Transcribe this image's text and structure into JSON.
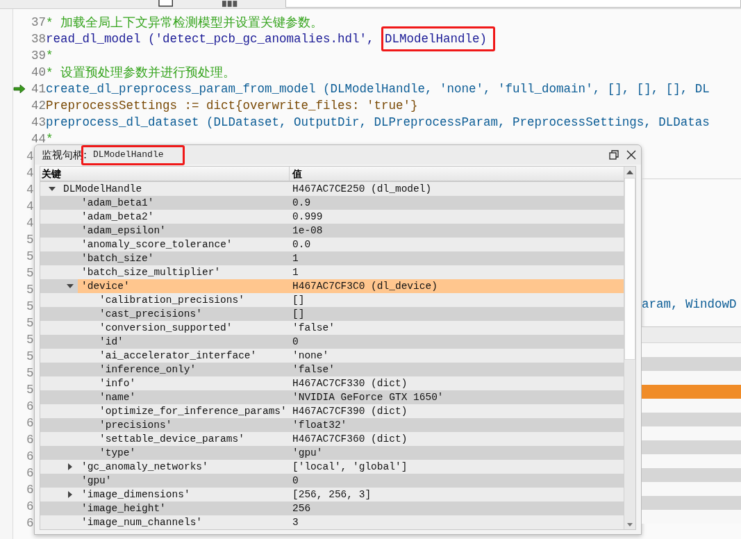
{
  "editor": {
    "lines": [
      {
        "number": "37",
        "current": false,
        "tokens": [
          {
            "text": "* 加载全局上下文异常检测模型并设置关键参数。",
            "kind": "comment",
            "boxed": false
          }
        ]
      },
      {
        "number": "38",
        "current": false,
        "tokens": [
          {
            "text": "read_dl_model ('detect_pcb_gc_anomalies.hdl', ",
            "kind": "operator",
            "boxed": false
          },
          {
            "text": "DLModelHandle)",
            "kind": "operator",
            "boxed": true
          }
        ]
      },
      {
        "number": "39",
        "current": false,
        "tokens": [
          {
            "text": "*",
            "kind": "comment",
            "boxed": false
          }
        ]
      },
      {
        "number": "40",
        "current": false,
        "tokens": [
          {
            "text": "* 设置预处理参数并进行预处理。",
            "kind": "comment",
            "boxed": false
          }
        ]
      },
      {
        "number": "41",
        "current": true,
        "tokens": [
          {
            "text": "create_dl_preprocess_param_from_model (DLModelHandle, 'none', 'full_domain', [], [], [], DL",
            "kind": "procedure",
            "boxed": false
          }
        ]
      },
      {
        "number": "42",
        "current": false,
        "tokens": [
          {
            "text": "PreprocessSettings := dict{overwrite_files: 'true'}",
            "kind": "assignment",
            "boxed": false
          }
        ]
      },
      {
        "number": "43",
        "current": false,
        "tokens": [
          {
            "text": "preprocess_dl_dataset (DLDataset, OutputDir, DLPreprocessParam, PreprocessSettings, DLDatas",
            "kind": "procedure",
            "boxed": false
          }
        ]
      },
      {
        "number": "44",
        "current": false,
        "tokens": [
          {
            "text": "*",
            "kind": "comment",
            "boxed": false
          }
        ]
      }
    ],
    "hidden_line_digits": [
      "4",
      "4",
      "4",
      "4",
      "4",
      "5",
      "5",
      "5",
      "5",
      "5",
      "5",
      "5",
      "5",
      "5",
      "5",
      "6",
      "6",
      "6",
      "6",
      "6",
      "6",
      "6",
      "6"
    ],
    "code_fragment": "aram, WindowD"
  },
  "watch_window": {
    "title": "监视句柄:",
    "handle": "DLModelHandle",
    "handle_boxed": true,
    "columns": [
      "关键",
      "值"
    ],
    "rows": [
      {
        "key": "DLModelHandle",
        "value": "H467AC7CE250 (dl_model)",
        "expanded": true,
        "selected": false,
        "children": [
          {
            "key": "'adam_beta1'",
            "value": "0.9",
            "selected": false
          },
          {
            "key": "'adam_beta2'",
            "value": "0.999",
            "selected": false
          },
          {
            "key": "'adam_epsilon'",
            "value": "1e-08",
            "selected": false
          },
          {
            "key": "'anomaly_score_tolerance'",
            "value": "0.0",
            "selected": false
          },
          {
            "key": "'batch_size'",
            "value": "1",
            "selected": false
          },
          {
            "key": "'batch_size_multiplier'",
            "value": "1",
            "selected": false
          },
          {
            "key": "'device'",
            "value": "H467AC7CF3C0 (dl_device)",
            "expanded": true,
            "selected": true,
            "children": [
              {
                "key": "'calibration_precisions'",
                "value": "[]",
                "selected": false
              },
              {
                "key": "'cast_precisions'",
                "value": "[]",
                "selected": false
              },
              {
                "key": "'conversion_supported'",
                "value": "'false'",
                "selected": false
              },
              {
                "key": "'id'",
                "value": "0",
                "selected": false
              },
              {
                "key": "'ai_accelerator_interface'",
                "value": "'none'",
                "selected": false
              },
              {
                "key": "'inference_only'",
                "value": "'false'",
                "selected": false
              },
              {
                "key": "'info'",
                "value": "H467AC7CF330 (dict)",
                "selected": false
              },
              {
                "key": "'name'",
                "value": "'NVIDIA GeForce GTX 1650'",
                "selected": false
              },
              {
                "key": "'optimize_for_inference_params'",
                "value": "H467AC7CF390 (dict)",
                "selected": false
              },
              {
                "key": "'precisions'",
                "value": "'float32'",
                "selected": false
              },
              {
                "key": "'settable_device_params'",
                "value": "H467AC7CF360 (dict)",
                "selected": false
              },
              {
                "key": "'type'",
                "value": "'gpu'",
                "selected": false
              }
            ]
          },
          {
            "key": "'gc_anomaly_networks'",
            "value": "['local', 'global']",
            "expanded": false,
            "selected": false
          },
          {
            "key": "'gpu'",
            "value": "0",
            "selected": false
          },
          {
            "key": "'image_dimensions'",
            "value": "[256, 256, 3]",
            "expanded": false,
            "selected": false
          },
          {
            "key": "'image_height'",
            "value": "256",
            "selected": false
          },
          {
            "key": "'image_num_channels'",
            "value": "3",
            "selected": false
          }
        ]
      }
    ]
  },
  "background_table": {
    "rows": [
      {
        "selected": false
      },
      {
        "selected": false
      },
      {
        "selected": false
      },
      {
        "selected": true
      },
      {
        "selected": false
      },
      {
        "selected": false
      },
      {
        "selected": false
      },
      {
        "selected": false
      },
      {
        "selected": false
      },
      {
        "selected": false
      },
      {
        "selected": false
      },
      {
        "selected": false
      },
      {
        "selected": false
      }
    ]
  }
}
